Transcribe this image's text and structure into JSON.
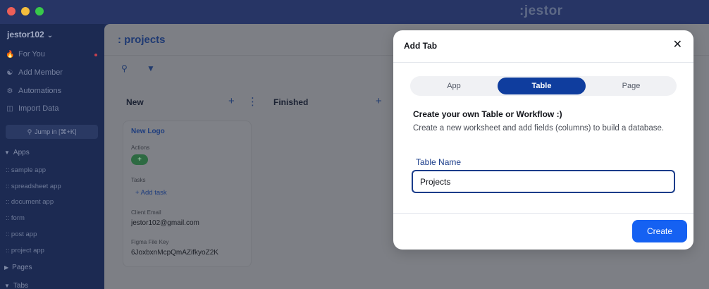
{
  "window": {
    "brand": ":jestor"
  },
  "sidebar": {
    "workspace": "jestor102",
    "nav": [
      {
        "label": "For You",
        "icon": "fire-icon"
      },
      {
        "label": "Add Member",
        "icon": "add-user-icon"
      },
      {
        "label": "Automations",
        "icon": "robot-icon"
      },
      {
        "label": "Import Data",
        "icon": "database-icon"
      }
    ],
    "jump": "Jump in [⌘+K]",
    "sections": {
      "apps": "Apps",
      "pages": "Pages",
      "tabs": "Tabs"
    },
    "apps": [
      ":: sample app",
      ":: spreadsheet app",
      ":: document app",
      ":: form",
      ":: post app",
      ":: project app"
    ]
  },
  "board": {
    "title": ": projects",
    "columns": [
      {
        "title": "New"
      },
      {
        "title": "Finished"
      }
    ],
    "card": {
      "title": "New Logo",
      "actions_label": "Actions",
      "action_pill": "+",
      "tasks_label": "Tasks",
      "add_task": "+ Add task",
      "email_label": "Client Email",
      "email": "jestor102@gmail.com",
      "figma_label": "Figma File Key",
      "figma": "6JoxbxnMcpQmAZifkyoZ2K"
    }
  },
  "modal": {
    "title": "Add Tab",
    "close": "✕",
    "tabs": [
      {
        "label": "App",
        "active": false
      },
      {
        "label": "Table",
        "active": true
      },
      {
        "label": "Page",
        "active": false
      }
    ],
    "heading": "Create your own Table or Workflow :)",
    "description": "Create a new worksheet and add fields (columns) to build a database.",
    "field_label": "Table Name",
    "field_value": "Projects",
    "create_label": "Create"
  },
  "colors": {
    "accent": "#1561f2",
    "active_tab": "#0f3d9e",
    "sidebar": "#1c2a52"
  }
}
